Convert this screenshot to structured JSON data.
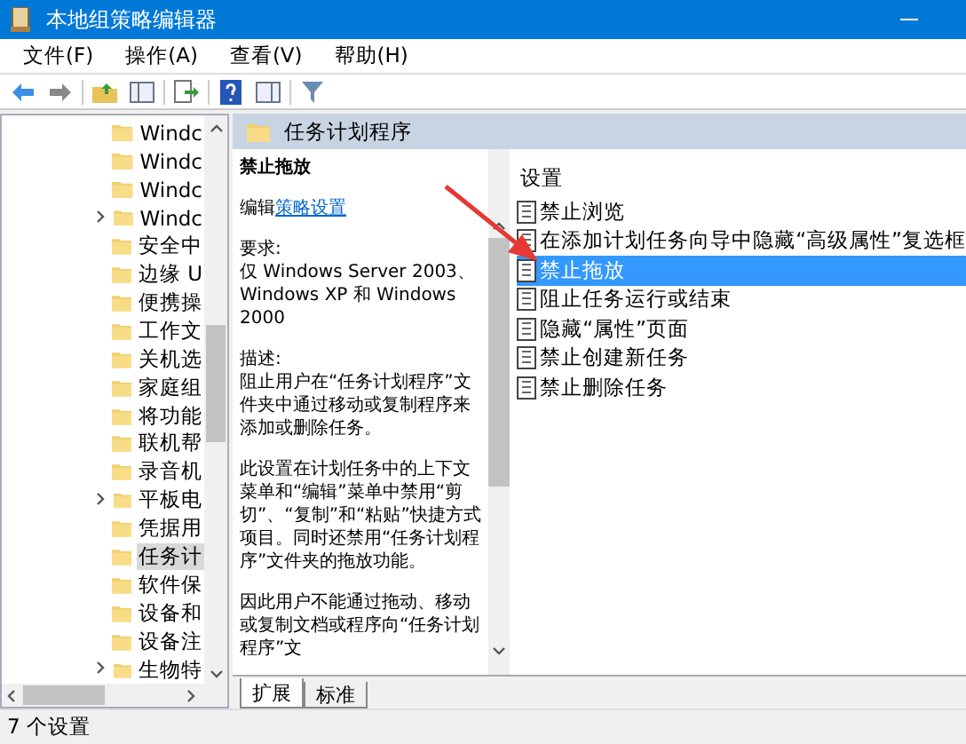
{
  "window": {
    "title": "本地组策略编辑器"
  },
  "menu": [
    "文件(F)",
    "操作(A)",
    "查看(V)",
    "帮助(H)"
  ],
  "toolbar": [
    {
      "kind": "back"
    },
    {
      "kind": "forward"
    },
    {
      "kind": "separator"
    },
    {
      "kind": "folder-up"
    },
    {
      "kind": "tree-toggle"
    },
    {
      "kind": "separator"
    },
    {
      "kind": "export"
    },
    {
      "kind": "separator"
    },
    {
      "kind": "help"
    },
    {
      "kind": "pane-toggle"
    },
    {
      "kind": "separator"
    },
    {
      "kind": "filter"
    }
  ],
  "tree": {
    "items": [
      {
        "label": "Windc",
        "expandable": false,
        "selected": false
      },
      {
        "label": "Windc",
        "expandable": false,
        "selected": false
      },
      {
        "label": "Windc",
        "expandable": false,
        "selected": false
      },
      {
        "label": "Windc",
        "expandable": true,
        "selected": false
      },
      {
        "label": "安全中",
        "expandable": false,
        "selected": false
      },
      {
        "label": "边缘 U",
        "expandable": false,
        "selected": false
      },
      {
        "label": "便携操",
        "expandable": false,
        "selected": false
      },
      {
        "label": "工作文",
        "expandable": false,
        "selected": false
      },
      {
        "label": "关机选",
        "expandable": false,
        "selected": false
      },
      {
        "label": "家庭组",
        "expandable": false,
        "selected": false
      },
      {
        "label": "将功能",
        "expandable": false,
        "selected": false
      },
      {
        "label": "联机帮",
        "expandable": false,
        "selected": false
      },
      {
        "label": "录音机",
        "expandable": false,
        "selected": false
      },
      {
        "label": "平板电",
        "expandable": true,
        "selected": false
      },
      {
        "label": "凭据用",
        "expandable": false,
        "selected": false
      },
      {
        "label": "任务计",
        "expandable": false,
        "selected": true
      },
      {
        "label": "软件保",
        "expandable": false,
        "selected": false
      },
      {
        "label": "设备和",
        "expandable": false,
        "selected": false
      },
      {
        "label": "设备注",
        "expandable": false,
        "selected": false
      },
      {
        "label": "生物特",
        "expandable": true,
        "selected": false
      }
    ]
  },
  "detail": {
    "header": "任务计划程序",
    "policy_title": "禁止拖放",
    "edit_prefix": "编辑",
    "edit_link": "策略设置",
    "requirements_label": "要求:",
    "requirements": "仅 Windows Server 2003、Windows XP 和 Windows 2000",
    "description_label": "描述:",
    "paragraphs": [
      "阻止用户在“任务计划程序”文件夹中通过移动或复制程序来添加或删除任务。",
      "此设置在计划任务中的上下文菜单和“编辑”菜单中禁用“剪切”、“复制”和“粘贴”快捷方式项目。同时还禁用“任务计划程序”文件夹的拖放功能。",
      "因此用户不能通过拖动、移动或复制文档或程序向“任务计划程序”文"
    ]
  },
  "settings": {
    "column": "设置",
    "items": [
      {
        "label": "禁止浏览",
        "selected": false
      },
      {
        "label": "在添加计划任务向导中隐藏“高级属性”复选框",
        "selected": false
      },
      {
        "label": "禁止拖放",
        "selected": true
      },
      {
        "label": "阻止任务运行或结束",
        "selected": false
      },
      {
        "label": "隐藏“属性”页面",
        "selected": false
      },
      {
        "label": "禁止创建新任务",
        "selected": false
      },
      {
        "label": "禁止删除任务",
        "selected": false
      }
    ]
  },
  "tabs": [
    {
      "label": "扩展",
      "selected": true
    },
    {
      "label": "标准",
      "selected": false
    }
  ],
  "status_bar": "7 个设置"
}
